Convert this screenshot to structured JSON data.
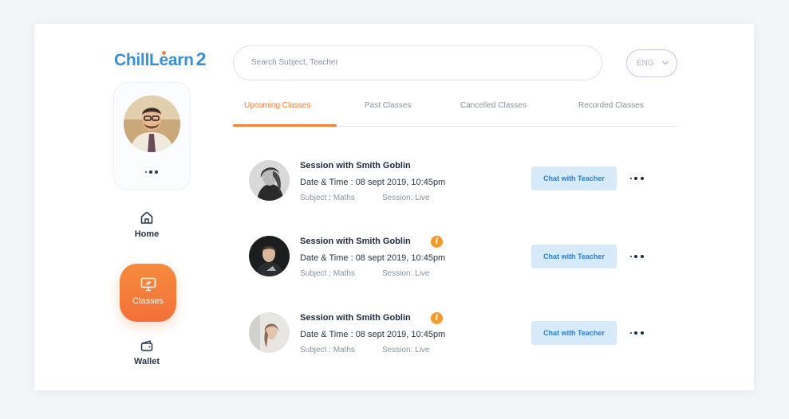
{
  "app": {
    "logo_text": "ChillLearn",
    "logo_number": "2"
  },
  "search": {
    "placeholder": "Search Subject, Teacher"
  },
  "language": {
    "value": "ENG"
  },
  "nav": {
    "home": "Home",
    "classes": "Classes",
    "wallet": "Wallet"
  },
  "tabs": [
    {
      "label": "Upcoming Classes",
      "active": true
    },
    {
      "label": "Past Classes",
      "active": false
    },
    {
      "label": "Cancelled Classes",
      "active": false
    },
    {
      "label": "Recorded Classes",
      "active": false
    }
  ],
  "sessions": [
    {
      "title": "Session with Smith Goblin",
      "info": false,
      "date_time": "Date & Time : 08 sept 2019, 10:45pm",
      "subject": "Subject : Maths",
      "session": "Session: Live",
      "action": "Chat with Teacher"
    },
    {
      "title": "Session with Smith Goblin",
      "info": true,
      "date_time": "Date & Time : 08 sept 2019, 10:45pm",
      "subject": "Subject : Maths",
      "session": "Session: Live",
      "action": "Chat with Teacher"
    },
    {
      "title": "Session with Smith Goblin",
      "info": true,
      "date_time": "Date & Time : 08 sept 2019, 10:45pm",
      "subject": "Subject : Maths",
      "session": "Session: Live",
      "action": "Chat with Teacher"
    }
  ],
  "colors": {
    "accent": "#f5813a",
    "brand": "#3a8fd6",
    "chat_button_bg": "#d6eaf9",
    "info_badge": "#f59a2a"
  }
}
